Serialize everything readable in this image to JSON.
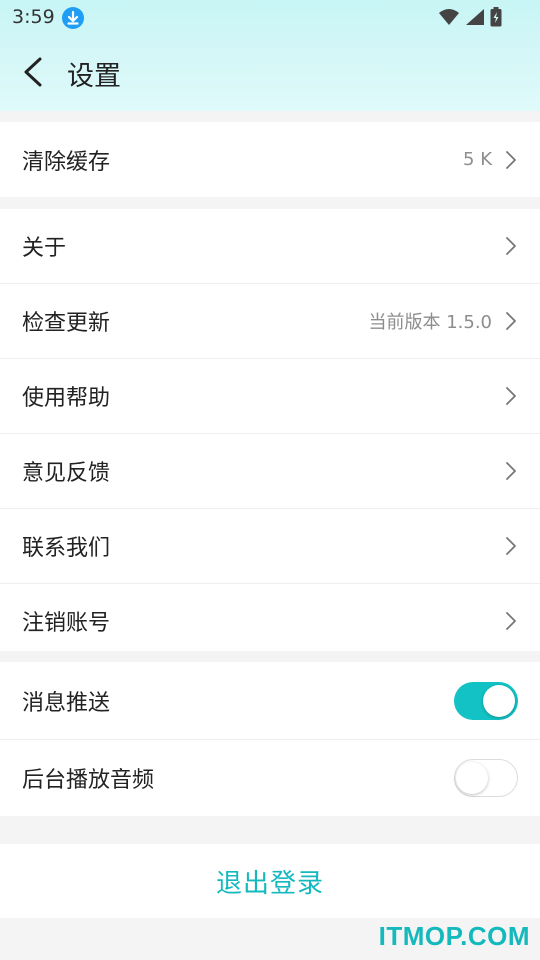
{
  "status_bar": {
    "time": "3:59"
  },
  "header": {
    "title": "设置"
  },
  "cache": {
    "label": "清除缓存",
    "value": "5 K"
  },
  "menu": [
    {
      "label": "关于",
      "value": ""
    },
    {
      "label": "检查更新",
      "value": "当前版本 1.5.0"
    },
    {
      "label": "使用帮助",
      "value": ""
    },
    {
      "label": "意见反馈",
      "value": ""
    },
    {
      "label": "联系我们",
      "value": ""
    },
    {
      "label": "注销账号",
      "value": ""
    }
  ],
  "toggles": [
    {
      "label": "消息推送",
      "on": true
    },
    {
      "label": "后台播放音频",
      "on": false
    }
  ],
  "logout": {
    "label": "退出登录"
  },
  "watermark": {
    "text": "ITMOP.COM"
  },
  "colors": {
    "accent": "#12c2c4",
    "header_bg": "#d4f7f7",
    "download_icon": "#1e9ef4"
  }
}
